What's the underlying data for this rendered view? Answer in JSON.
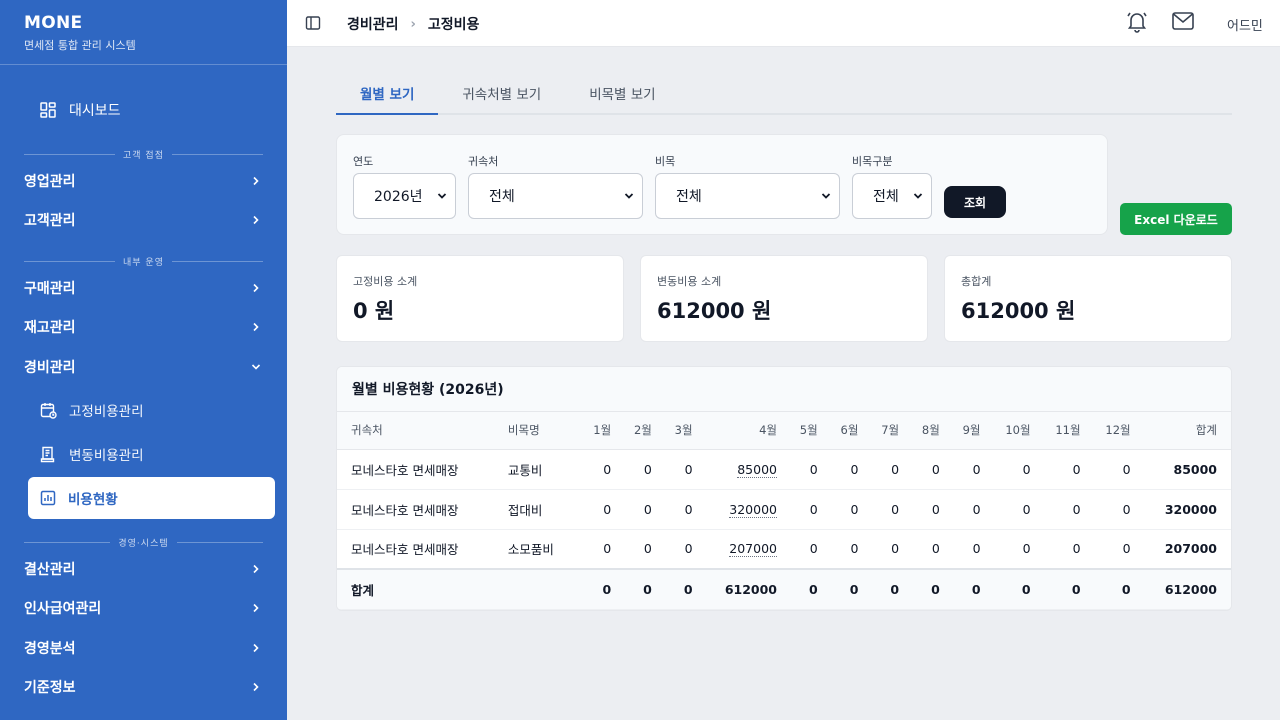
{
  "app": {
    "name": "MONE",
    "subtitle": "면세점 통합 관리 시스템"
  },
  "sidebar": {
    "dashboard": "대시보드",
    "sections": [
      {
        "label": "고객 접점"
      },
      {
        "label": "내부 운영"
      },
      {
        "label": "경영·시스템"
      }
    ],
    "items": [
      {
        "label": "영업관리"
      },
      {
        "label": "고객관리"
      },
      {
        "label": "구매관리"
      },
      {
        "label": "재고관리"
      },
      {
        "label": "경비관리"
      },
      {
        "label": "결산관리"
      },
      {
        "label": "인사급여관리"
      },
      {
        "label": "경영분석"
      },
      {
        "label": "기준정보"
      }
    ],
    "subitems": [
      {
        "label": "고정비용관리"
      },
      {
        "label": "변동비용관리"
      },
      {
        "label": "비용현황"
      }
    ]
  },
  "header": {
    "breadcrumb": [
      "경비관리",
      "고정비용"
    ],
    "separator": "›",
    "user": "어드민"
  },
  "tabs": [
    {
      "label": "월별 보기",
      "active": true
    },
    {
      "label": "귀속처별 보기",
      "active": false
    },
    {
      "label": "비목별 보기",
      "active": false
    }
  ],
  "filters": {
    "year": {
      "label": "연도",
      "value": "2026년"
    },
    "owner": {
      "label": "귀속처",
      "value": "전체"
    },
    "item": {
      "label": "비목",
      "value": "전체"
    },
    "category": {
      "label": "비목구분",
      "value": "전체"
    },
    "search_button": "조회",
    "excel_button": "Excel 다운로드"
  },
  "summary": [
    {
      "label": "고정비용 소계",
      "value": "0 원"
    },
    {
      "label": "변동비용 소계",
      "value": "612000 원"
    },
    {
      "label": "총합계",
      "value": "612000 원"
    }
  ],
  "table": {
    "title": "월별 비용현황 (2026년)",
    "headers": [
      "귀속처",
      "비목명",
      "1월",
      "2월",
      "3월",
      "4월",
      "5월",
      "6월",
      "7월",
      "8월",
      "9월",
      "10월",
      "11월",
      "12월",
      "합계"
    ],
    "rows": [
      [
        "모네스타호 면세매장",
        "교통비",
        "0",
        "0",
        "0",
        "85000",
        "0",
        "0",
        "0",
        "0",
        "0",
        "0",
        "0",
        "0",
        "85000"
      ],
      [
        "모네스타호 면세매장",
        "접대비",
        "0",
        "0",
        "0",
        "320000",
        "0",
        "0",
        "0",
        "0",
        "0",
        "0",
        "0",
        "0",
        "320000"
      ],
      [
        "모네스타호 면세매장",
        "소모품비",
        "0",
        "0",
        "0",
        "207000",
        "0",
        "0",
        "0",
        "0",
        "0",
        "0",
        "0",
        "0",
        "207000"
      ]
    ],
    "total": [
      "합계",
      "",
      "0",
      "0",
      "0",
      "612000",
      "0",
      "0",
      "0",
      "0",
      "0",
      "0",
      "0",
      "0",
      "612000"
    ]
  },
  "colors": {
    "sidebar": "#2f67c2",
    "accent": "#2f67c2",
    "excel": "#16a34a",
    "button": "#111827"
  }
}
